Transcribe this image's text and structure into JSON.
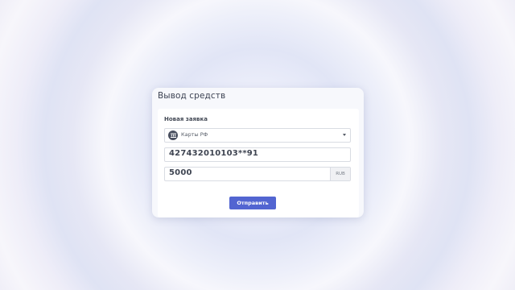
{
  "window": {
    "title": "Вывод средств"
  },
  "form": {
    "section_title": "Новая заявка",
    "method_select": {
      "selected": "Карты РФ",
      "icon": "bank-card-icon"
    },
    "card_number": {
      "value": "427432010103**91"
    },
    "amount": {
      "value": "5000",
      "currency": "RUB"
    },
    "submit_label": "Отправить"
  },
  "colors": {
    "accent": "#5265d1",
    "card_bg": "#f7f8fc",
    "text": "#3f4552"
  }
}
